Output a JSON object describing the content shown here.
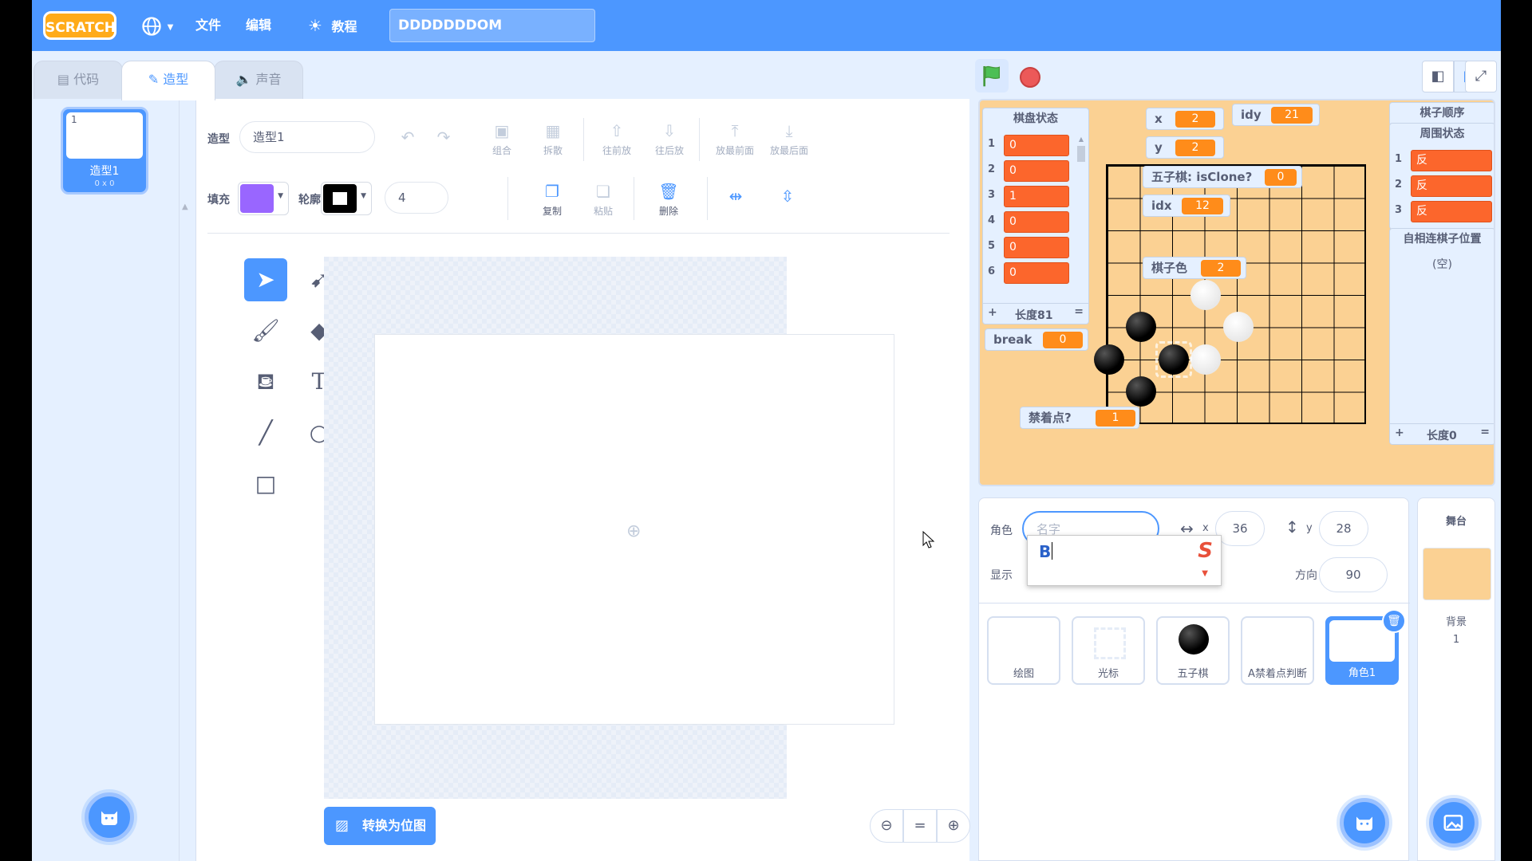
{
  "menubar": {
    "logo": "SCRATCH",
    "file": "文件",
    "edit": "编辑",
    "tutorials": "教程",
    "project_title": "DDDDDDDOM"
  },
  "tabs": {
    "code": "代码",
    "costumes": "造型",
    "sounds": "声音"
  },
  "costume_list": {
    "items": [
      {
        "number": "1",
        "name": "造型1",
        "size": "0 x 0"
      }
    ]
  },
  "editor": {
    "costume_label": "造型",
    "costume_name": "造型1",
    "fill_label": "填充",
    "outline_label": "轮廓",
    "outline_width": "4",
    "fill_color": "#9966ff",
    "outline_color": "#000000",
    "group": "组合",
    "ungroup": "拆散",
    "forward": "往前放",
    "backward": "往后放",
    "front": "放最前面",
    "back": "放最后面",
    "copy": "复制",
    "paste": "粘贴",
    "delete": "删除",
    "convert_bitmap": "转换为位图",
    "zoom_reset": "="
  },
  "stage": {
    "background_color": "#fbd193",
    "board_state_list": {
      "title": "棋盘状态",
      "items": [
        "0",
        "0",
        "1",
        "0",
        "0",
        "0"
      ],
      "indices": [
        "1",
        "2",
        "3",
        "4",
        "5",
        "6"
      ],
      "length": "长度81"
    },
    "piece_order_list": {
      "title": "棋子顺序"
    },
    "surround_list": {
      "title": "周围状态",
      "items": [
        "反",
        "反",
        "反"
      ],
      "indices": [
        "1",
        "2",
        "3"
      ]
    },
    "self_connect_list": {
      "title": "自相连棋子位置",
      "empty": "(空)",
      "length": "长度0"
    },
    "vars": {
      "x": {
        "label": "x",
        "value": "2"
      },
      "y": {
        "label": "y",
        "value": "2"
      },
      "idy": {
        "label": "idy",
        "value": "21"
      },
      "isclone": {
        "label": "五子棋: isClone?",
        "value": "0"
      },
      "idx": {
        "label": "idx",
        "value": "12"
      },
      "piece_color": {
        "label": "棋子色",
        "value": "2"
      },
      "break": {
        "label": "break",
        "value": "0"
      },
      "forbidden": {
        "label": "禁着点?",
        "value": "1"
      }
    }
  },
  "sprite_info": {
    "sprite_label": "角色",
    "name_placeholder": "名字",
    "x_label": "x",
    "x_value": "36",
    "y_label": "y",
    "y_value": "28",
    "show_label": "显示",
    "direction_label": "方向",
    "direction_value": "90",
    "ime_text": "B"
  },
  "sprites": [
    {
      "name": "绘图"
    },
    {
      "name": "光标"
    },
    {
      "name": "五子棋"
    },
    {
      "name": "A禁着点判断"
    },
    {
      "name": "角色1"
    }
  ],
  "stage_pane": {
    "title": "舞台",
    "backdrop_label": "背景",
    "backdrop_count": "1"
  }
}
